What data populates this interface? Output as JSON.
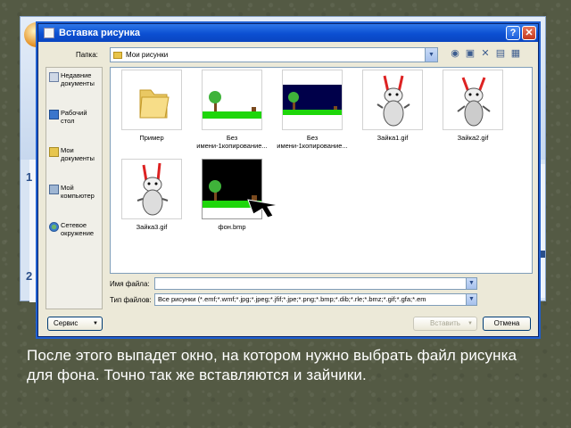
{
  "dialog": {
    "title": "Вставка рисунка",
    "folder_label": "Папка:",
    "folder_value": "Мои рисунки",
    "toolbar_icons": [
      "back-icon",
      "up-folder-icon",
      "delete-icon",
      "new-folder-icon",
      "views-icon"
    ],
    "places": [
      {
        "label": "Недавние документы",
        "icon": "recent-icon"
      },
      {
        "label": "Рабочий стол",
        "icon": "desktop-icon"
      },
      {
        "label": "Мои документы",
        "icon": "my-documents-icon"
      },
      {
        "label": "Мой компьютер",
        "icon": "my-computer-icon"
      },
      {
        "label": "Сетевое окружение",
        "icon": "network-icon"
      }
    ],
    "files": [
      {
        "name": "Пример",
        "kind": "folder"
      },
      {
        "name": "Без имени-1копирование...",
        "kind": "tree-green"
      },
      {
        "name": "Без имени-1копирование...",
        "kind": "tree-dark"
      },
      {
        "name": "Зайка1.gif",
        "kind": "bunny"
      },
      {
        "name": "Зайка2.gif",
        "kind": "bunny"
      },
      {
        "name": "Зайка3.gif",
        "kind": "bunny"
      },
      {
        "name": "фон.bmp",
        "kind": "tree-black"
      }
    ],
    "filename_label": "Имя файла:",
    "filename_value": "",
    "filetype_label": "Тип файлов:",
    "filetype_value": "Все рисунки (*.emf;*.wmf;*.jpg;*.jpeg;*.jfif;*.jpe;*.png;*.bmp;*.dib;*.rle;*.bmz;*.gif;*.gfa;*.em",
    "service_button": "Сервис",
    "insert_button": "Вставить",
    "cancel_button": "Отмена"
  },
  "background_app": {
    "left_numbers": [
      "1",
      "2"
    ]
  },
  "caption": "После этого выпадет окно, на котором нужно выбрать файл рисунка для фона. Точно так же вставляются и зайчики."
}
